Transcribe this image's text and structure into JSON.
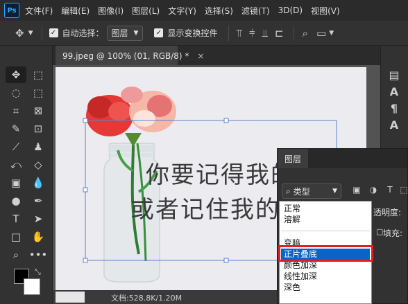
{
  "app": {
    "logo": "Ps"
  },
  "menubar": {
    "items": [
      "文件(F)",
      "编辑(E)",
      "图像(I)",
      "图层(L)",
      "文字(Y)",
      "选择(S)",
      "滤镜(T)",
      "3D(D)",
      "视图(V)"
    ]
  },
  "options": {
    "auto_select_label": "自动选择：",
    "auto_select_target": "图层",
    "show_transform_label": "显示变换控件",
    "checkmark": "✓"
  },
  "document": {
    "tab_title": "99.jpeg @ 100% (01, RGB/8) *",
    "close_glyph": "×",
    "canvas_text_line1": "你要记得我的",
    "canvas_text_line2": "或者记住我的",
    "status_text": "文档:528.8K/1.20M"
  },
  "layers_panel": {
    "tab_label": "图层",
    "kind_label": "类型",
    "opacity_label": "透明度:",
    "fill_label": "填充:"
  },
  "blend_menu": {
    "items": [
      "正常",
      "溶解",
      "变暗",
      "正片叠底",
      "颜色加深",
      "线性加深",
      "深色"
    ],
    "selected": "正片叠底"
  },
  "colors": {
    "accent_selection": "#0a64c8",
    "highlight_box": "#e02020",
    "ps_blue": "#31a8ff"
  }
}
